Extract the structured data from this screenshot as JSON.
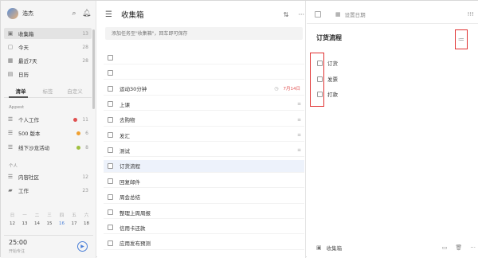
{
  "user": {
    "name": "浩杰"
  },
  "sidebar": {
    "smart_lists": [
      {
        "label": "收集箱",
        "count": "13",
        "icon": "inbox-icon"
      },
      {
        "label": "今天",
        "count": "28",
        "icon": "today-icon"
      },
      {
        "label": "最近7天",
        "count": "28",
        "icon": "week-icon"
      },
      {
        "label": "日历",
        "count": "",
        "icon": "calendar-icon"
      }
    ],
    "tabs": [
      "清单",
      "标签",
      "自定义"
    ],
    "group1": "Appest",
    "lists1": [
      {
        "label": "个人工作",
        "count": "11",
        "color": "#e05050"
      },
      {
        "label": "500 版本",
        "count": "6",
        "color": "#f0a030"
      },
      {
        "label": "线下沙龙活动",
        "count": "8",
        "color": "#a0c040"
      }
    ],
    "group2": "个人",
    "lists2": [
      {
        "label": "内容社区",
        "count": "12"
      },
      {
        "label": "工作",
        "count": "23"
      }
    ],
    "calendar": {
      "weekdays": [
        "日",
        "一",
        "二",
        "三",
        "四",
        "五",
        "六"
      ],
      "dates": [
        "12",
        "13",
        "14",
        "15",
        "16",
        "17",
        "18"
      ],
      "today_index": 4
    },
    "pomodoro": {
      "time": "25:00",
      "sub": "开始专注"
    }
  },
  "main": {
    "title": "收集箱",
    "add_placeholder": "添加任务至\"收集箱\"，回车即可保存",
    "tasks": [
      {
        "title": "",
        "date": "",
        "sub": ""
      },
      {
        "title": "",
        "date": "",
        "sub": ""
      },
      {
        "title": "运动30分钟",
        "date": "7月14日",
        "sub": ""
      },
      {
        "title": "上课",
        "date": "",
        "sub": "≡"
      },
      {
        "title": "去购物",
        "date": "",
        "sub": "≡"
      },
      {
        "title": "发汇",
        "date": "",
        "sub": "≡"
      },
      {
        "title": "测试",
        "date": "",
        "sub": "≡"
      },
      {
        "title": "订货流程",
        "date": "",
        "sub": ""
      },
      {
        "title": "回复邮件",
        "date": "",
        "sub": ""
      },
      {
        "title": "周会总结",
        "date": "",
        "sub": ""
      },
      {
        "title": "整理上周周报",
        "date": "",
        "sub": ""
      },
      {
        "title": "信用卡还款",
        "date": "",
        "sub": ""
      },
      {
        "title": "应用发布预测",
        "date": "",
        "sub": ""
      }
    ]
  },
  "detail": {
    "set_date": "设置日期",
    "title": "订货流程",
    "subtasks": [
      "订货",
      "发票",
      "打款"
    ],
    "footer_list": "收集箱"
  }
}
